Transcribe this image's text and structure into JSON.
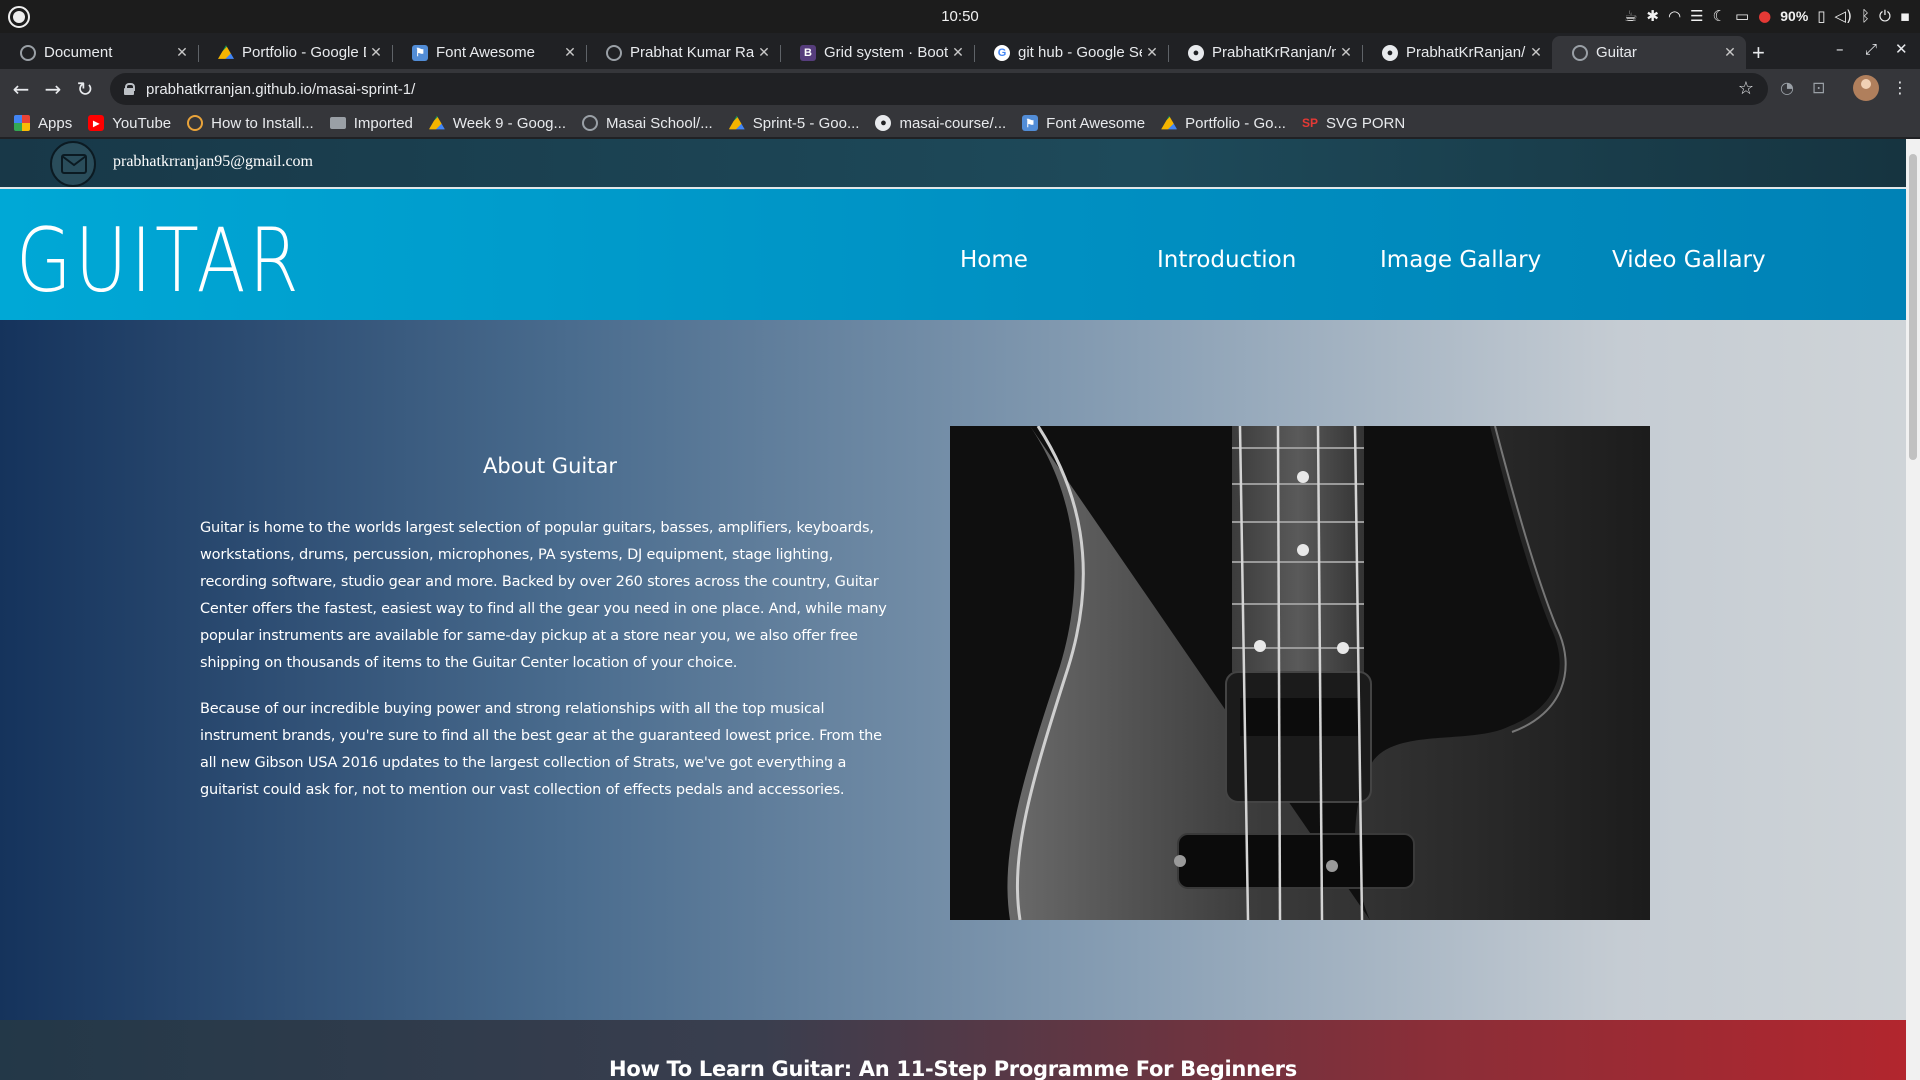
{
  "os": {
    "clock": "10:50",
    "battery": "90%"
  },
  "tabs": [
    {
      "title": "Document",
      "favicon": "globe-icon"
    },
    {
      "title": "Portfolio - Google Drive",
      "favicon": "drive-icon"
    },
    {
      "title": "Font Awesome",
      "favicon": "flag-icon"
    },
    {
      "title": "Prabhat Kumar Ranjan",
      "favicon": "globe-icon"
    },
    {
      "title": "Grid system · Bootstrap",
      "favicon": "bootstrap-icon"
    },
    {
      "title": "git hub - Google Search",
      "favicon": "google-icon"
    },
    {
      "title": "PrabhatKrRanjan/masai",
      "favicon": "github-icon"
    },
    {
      "title": "PrabhatKrRanjan/masai",
      "favicon": "github-icon"
    },
    {
      "title": "Guitar",
      "favicon": "globe-icon"
    }
  ],
  "toolbar": {
    "url": "prabhatkrranjan.github.io/masai-sprint-1/"
  },
  "bookmarks": [
    {
      "label": "Apps",
      "icon": "apps-grid-icon"
    },
    {
      "label": "YouTube",
      "icon": "youtube-icon"
    },
    {
      "label": "How to Install...",
      "icon": "globe-icon"
    },
    {
      "label": "Imported",
      "icon": "folder-icon"
    },
    {
      "label": "Week 9 - Goog...",
      "icon": "drive-icon"
    },
    {
      "label": "Masai School/...",
      "icon": "globe-icon"
    },
    {
      "label": "Sprint-5 - Goo...",
      "icon": "drive-icon"
    },
    {
      "label": "masai-course/...",
      "icon": "github-icon"
    },
    {
      "label": "Font Awesome",
      "icon": "flag-icon"
    },
    {
      "label": "Portfolio - Go...",
      "icon": "drive-icon"
    },
    {
      "label": "SVG PORN",
      "icon": "svg-porn-icon"
    }
  ],
  "site": {
    "email": "prabhatkrranjan95@gmail.com",
    "logo_text": "GUITAR",
    "nav": [
      "Home",
      "Introduction",
      "Image Gallary",
      "Video Gallary"
    ],
    "about_title": "About Guitar",
    "about_para1": "Guitar is home to the worlds largest selection of popular guitars, basses, amplifiers, keyboards, workstations, drums, percussion, microphones, PA systems, DJ equipment, stage lighting, recording software, studio gear and more. Backed by over 260 stores across the country, Guitar Center offers the fastest, easiest way to find all the gear you need in one place. And, while many popular instruments are available for same-day pickup at a store near you, we also offer free shipping on thousands of items to the Guitar Center location of your choice.",
    "about_para2": "Because of our incredible buying power and strong relationships with all the top musical instrument brands, you're sure to find all the best gear at the guaranteed lowest price. From the all new Gibson USA 2016 updates to the largest collection of Strats, we've got everything a guitarist could ask for, not to mention our vast collection of effects pedals and accessories.",
    "steps_title": "How To Learn Guitar: An 11-Step Programme For Beginners"
  }
}
